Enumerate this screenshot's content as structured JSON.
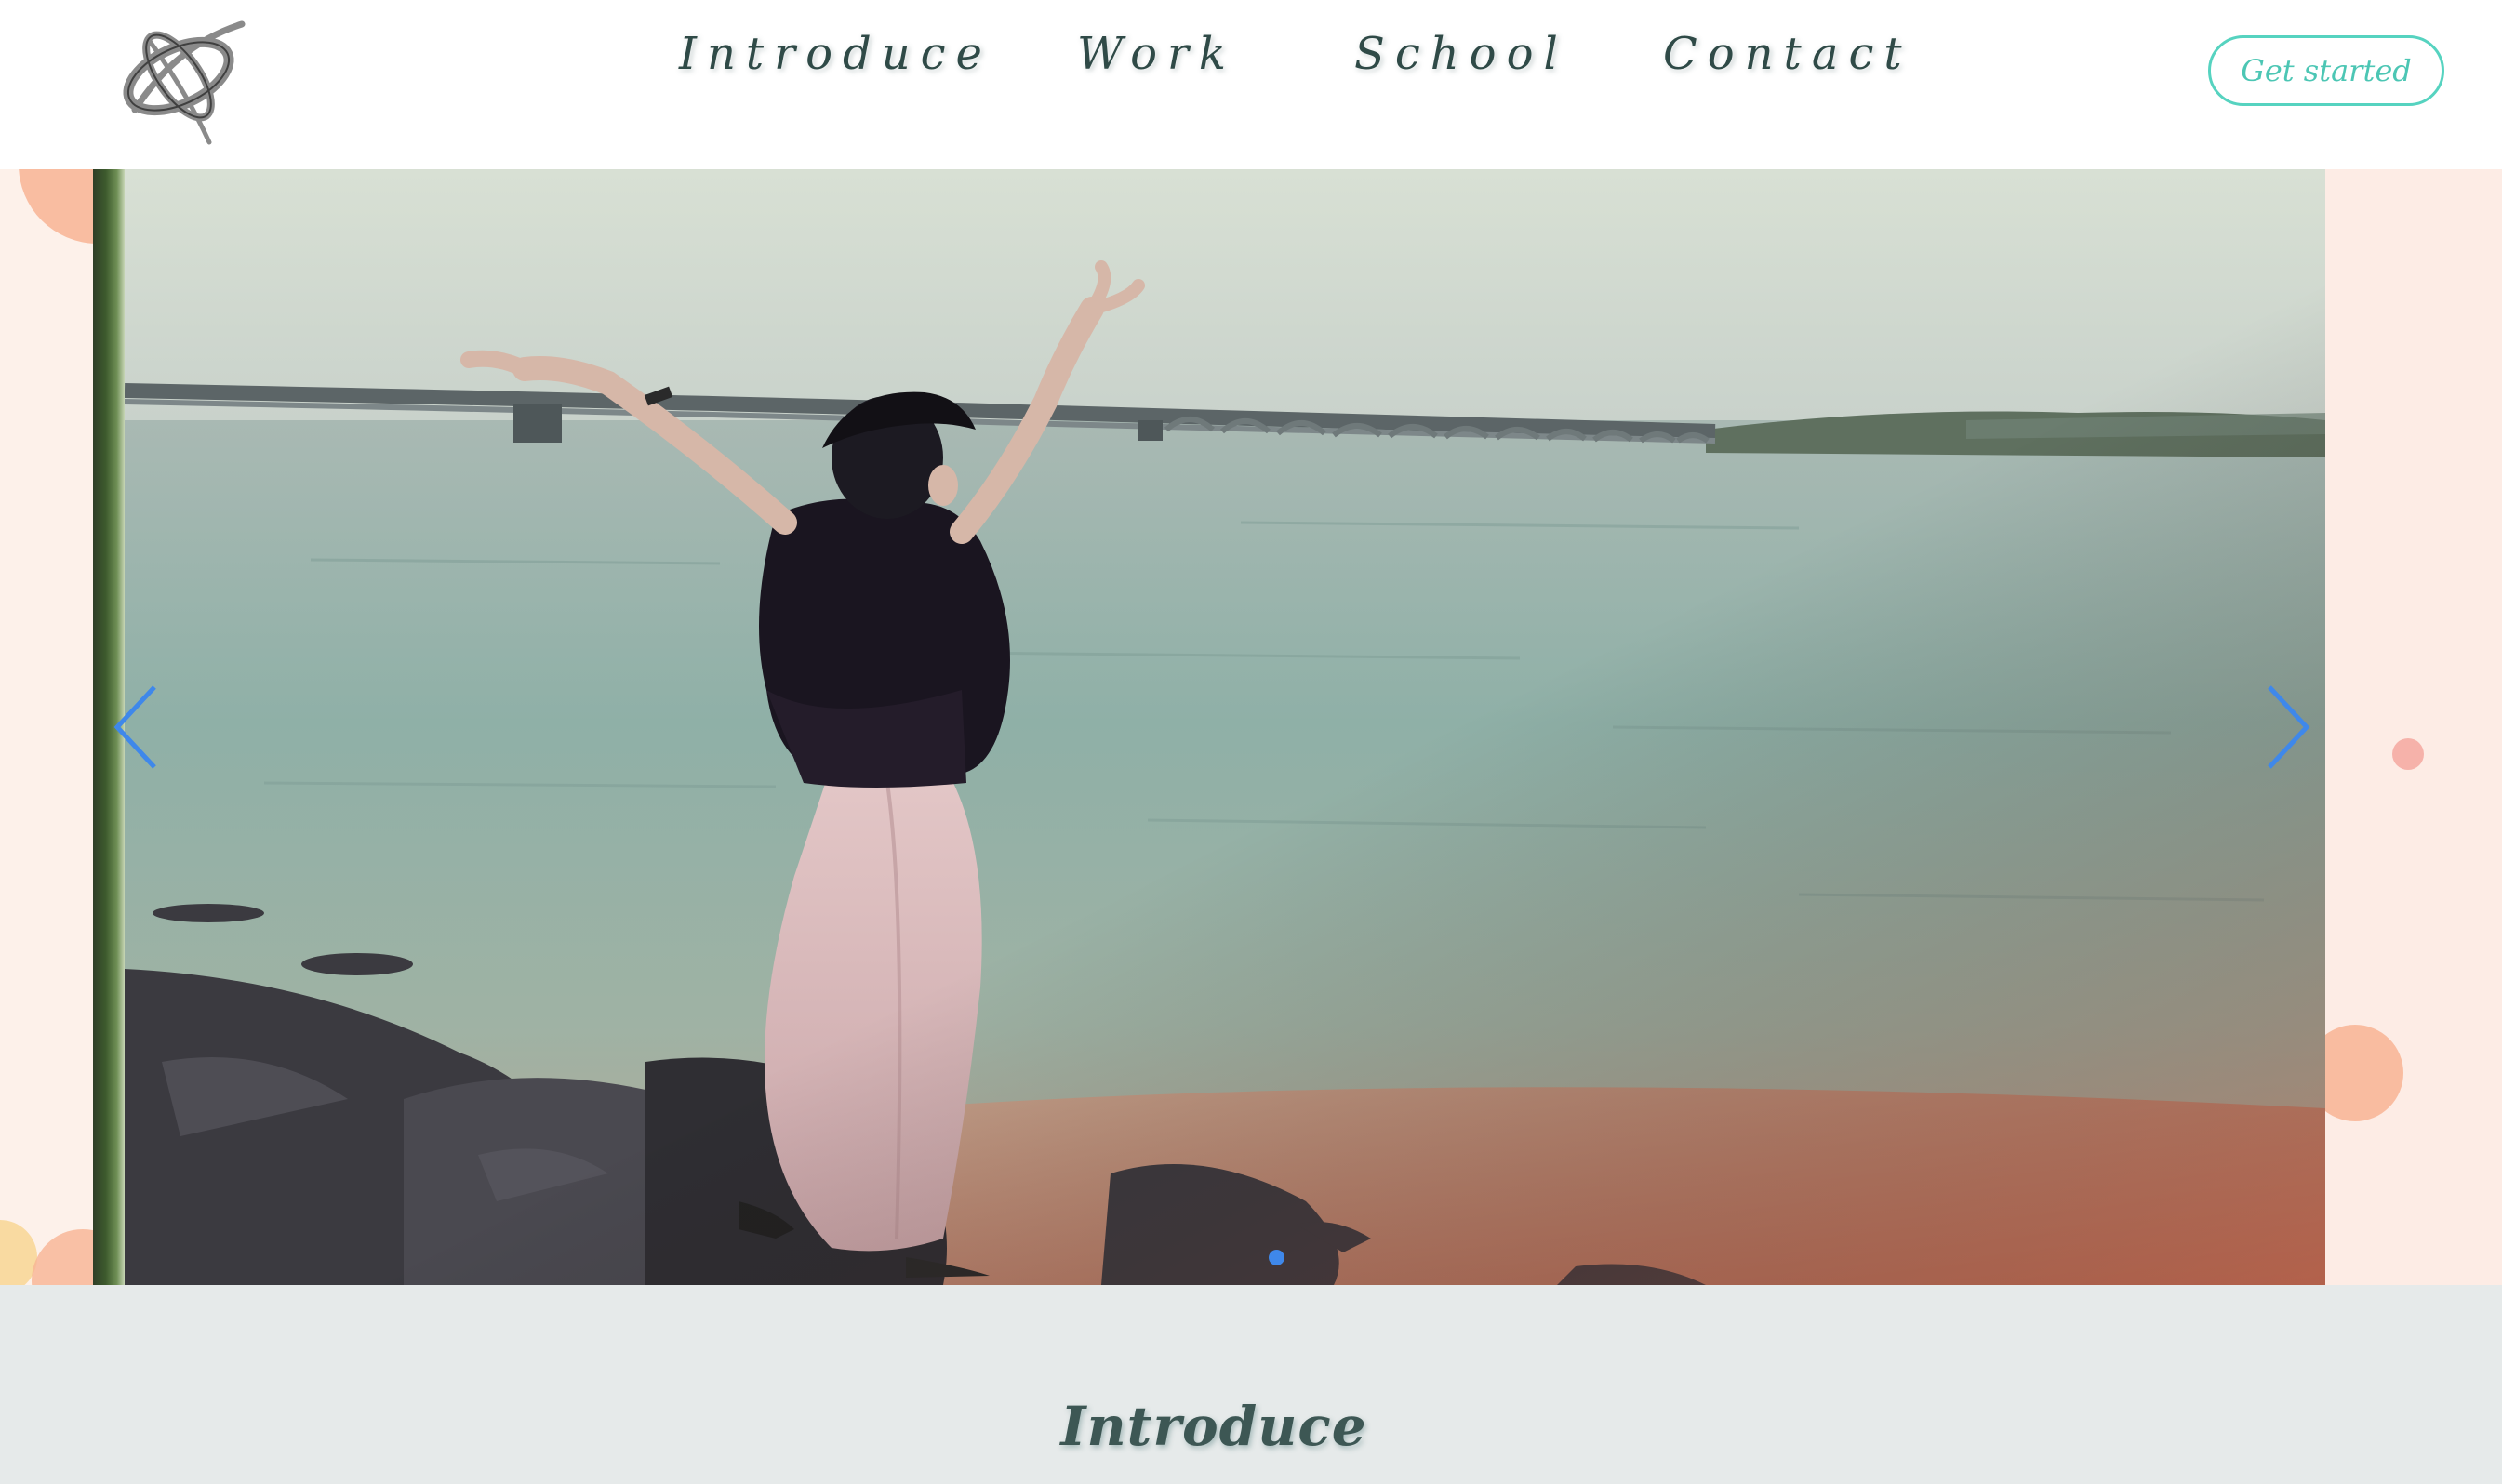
{
  "header": {
    "logo_icon": "swirl-logo-icon",
    "nav": [
      {
        "label": "Introduce"
      },
      {
        "label": "Work"
      },
      {
        "label": "School"
      },
      {
        "label": "Contact"
      }
    ],
    "cta_label": "Get started"
  },
  "slider": {
    "prev_icon": "chevron-left-icon",
    "next_icon": "chevron-right-icon",
    "dot_count": 1,
    "active_dot": 1,
    "slide_image": "woman-with-raised-arms-on-seaside-rocks",
    "colors": {
      "arrow": "#3f88ea",
      "dot": "#3f88ea"
    }
  },
  "intro": {
    "title": "Introduce"
  },
  "colors": {
    "accent": "#56d3c0",
    "nav_text": "#2f4a47",
    "intro_bg": "#e6eaea",
    "side_bg": "#fdf1ea",
    "bubble": "#f8b494"
  }
}
